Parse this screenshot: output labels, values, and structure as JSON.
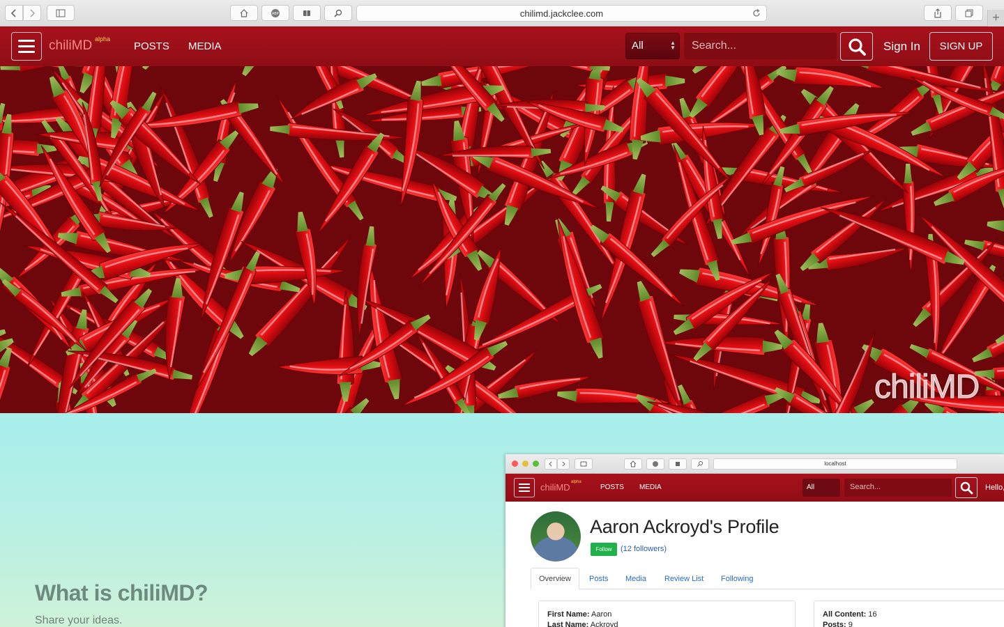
{
  "browser": {
    "url": "chilimd.jackclee.com",
    "new_tab_symbol": "+"
  },
  "nav": {
    "brand": "chiliMD",
    "brand_sup": "alpha",
    "links": [
      "POSTS",
      "MEDIA"
    ],
    "filter_value": "All",
    "search_placeholder": "Search...",
    "sign_in": "Sign In",
    "sign_up": "SIGN UP"
  },
  "hero": {
    "watermark": "chiliMD"
  },
  "intro": {
    "heading": "What is chiliMD?",
    "subheading": "Share your ideas."
  },
  "screenshot": {
    "url": "localhost",
    "brand": "chiliMD",
    "brand_sup": "alpha",
    "links": [
      "POSTS",
      "MEDIA"
    ],
    "filter_value": "All",
    "search_placeholder": "Search...",
    "greeting": "Hello,",
    "profile_title": "Aaron Ackroyd's Profile",
    "follow_label": "Follow",
    "followers_text": "(12 followers)",
    "tabs": [
      "Overview",
      "Posts",
      "Media",
      "Review List",
      "Following"
    ],
    "card_left": {
      "first_name_label": "First Name:",
      "first_name": "Aaron",
      "last_name_label": "Last Name:",
      "last_name": "Ackroyd"
    },
    "card_right": {
      "all_content_label": "All Content:",
      "all_content": "16",
      "posts_label": "Posts:",
      "posts": "9"
    }
  },
  "colors": {
    "nav_red": "#a8111c",
    "brand_pink": "#ff8a8a",
    "alpha_yellow": "#ffcf4d",
    "teal_bg": "#a8efec",
    "follow_green": "#1fb24a",
    "link_blue": "#2a6ac4"
  },
  "icons": [
    "chevron-left-icon",
    "chevron-right-icon",
    "sidebar-icon",
    "home-icon",
    "adblock-icon",
    "reader-icon",
    "search-icon",
    "reload-icon",
    "share-icon",
    "tabs-icon",
    "menu-icon"
  ]
}
